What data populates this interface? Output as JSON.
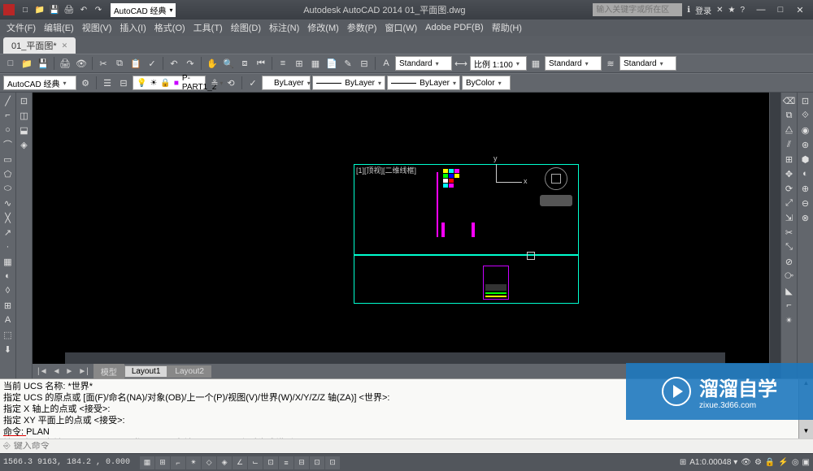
{
  "titlebar": {
    "workspace": "AutoCAD 经典",
    "app_title": "Autodesk AutoCAD 2014   01_平面图.dwg",
    "search_placeholder": "输入关键字或所在区",
    "login": "登录",
    "min": "—",
    "max": "□",
    "close": "✕"
  },
  "menu": {
    "file": "文件(F)",
    "edit": "编辑(E)",
    "view": "视图(V)",
    "insert": "插入(I)",
    "format": "格式(O)",
    "tools": "工具(T)",
    "draw": "绘图(D)",
    "dimension": "标注(N)",
    "modify": "修改(M)",
    "param": "参数(P)",
    "window": "窗口(W)",
    "adobe": "Adobe PDF(B)",
    "help": "帮助(H)"
  },
  "doctab": {
    "name": "01_平面图*"
  },
  "tb1": {
    "style1": "Standard",
    "scale": "比例 1:100",
    "style2": "Standard",
    "style3": "Standard"
  },
  "tb2": {
    "ws": "AutoCAD 经典",
    "layer": "P-PART1_2",
    "bylayer": "ByLayer",
    "bylayer2": "ByLayer",
    "bycolor": "ByColor"
  },
  "viewport": {
    "title": "[1][顶视][二维线框]",
    "x": "x",
    "y": "y"
  },
  "layout_tabs": {
    "model": "模型",
    "l1": "Layout1",
    "l2": "Layout2"
  },
  "cmd": {
    "l1": "当前 UCS 名称: *世界*",
    "l2": "指定 UCS 的原点或 [面(F)/命名(NA)/对象(OB)/上一个(P)/视图(V)/世界(W)/X/Y/Z/Z 轴(ZA)] <世界>:",
    "l3": "指定 X 轴上的点或 <接受>:",
    "l4": "指定 XY 平面上的点或 <接受>:",
    "l5a": "命令: ",
    "l5b": "PLAN",
    "l6a": "输入选项 [",
    "l6b": "当前 UCS(C)/UCS(U)/世界(W)",
    "l6c": "] <",
    "l6d": "当前 UCS",
    "l6e": ">: c 正在重生成模型。",
    "prompt": "⎆",
    "input_ph": "键入命令"
  },
  "status": {
    "coords": "1566.3 9163,   184.2 ,   0.000",
    "right": "A1:0.00048 ▾"
  },
  "watermark": {
    "main": "溜溜自学",
    "sub": "zixue.3d66.com"
  },
  "icons": {
    "new": "□",
    "open": "📁",
    "save": "💾",
    "print": "🖨",
    "undo": "↶",
    "redo": "↷",
    "search": "🔍",
    "info": "ℹ",
    "star": "★",
    "user": "👤",
    "help": "?",
    "line": "╱",
    "circle": "○",
    "arc": "⌒",
    "rect": "▭",
    "poly": "⬠",
    "ellipse": "⬭",
    "hatch": "▦",
    "text": "A",
    "dim": "⟷",
    "move": "✥",
    "copy": "⧉",
    "rotate": "⟳",
    "mirror": "⧋",
    "scale": "⤢",
    "trim": "✂",
    "extend": "⤡",
    "fillet": "⌐",
    "array": "⊞",
    "pan": "✋",
    "zoom": "🔍",
    "orbit": "⟲",
    "layers": "☰",
    "props": "≡",
    "match": "✓",
    "bulb": "💡",
    "lock": "🔒",
    "color": "■",
    "dd": "▾",
    "left": "◄",
    "right": "►",
    "first": "|◄",
    "last": "►|",
    "up": "▲",
    "down": "▼"
  }
}
